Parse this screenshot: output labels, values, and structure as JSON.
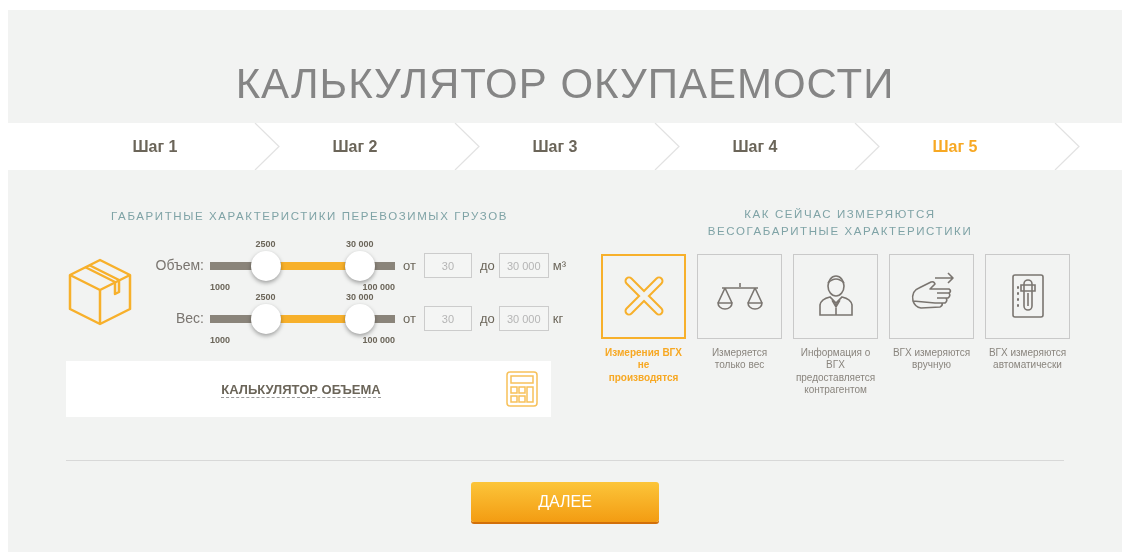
{
  "title": "КАЛЬКУЛЯТОР ОКУПАЕМОСТИ",
  "steps": [
    {
      "label": "Шаг 1",
      "selected": false
    },
    {
      "label": "Шаг 2",
      "selected": false
    },
    {
      "label": "Шаг 3",
      "selected": false
    },
    {
      "label": "Шаг 4",
      "selected": false
    },
    {
      "label": "Шаг 5",
      "selected": true
    }
  ],
  "cargo": {
    "heading": "ГАБАРИТНЫЕ ХАРАКТЕРИСТИКИ ПЕРЕВОЗИМЫХ  ГРУЗОВ",
    "sliders": [
      {
        "label": "Объем:",
        "min_label": "1000",
        "max_label": "100 000",
        "thumbs": [
          {
            "label": "2500",
            "level": 0.3
          },
          {
            "label": "30 000",
            "level": 0.81
          }
        ],
        "from_label": "от",
        "from_value": "30",
        "to_label": "до",
        "to_value": "30 000",
        "unit": "м³"
      },
      {
        "label": "Вес:",
        "min_label": "1000",
        "max_label": "100 000",
        "thumbs": [
          {
            "label": "2500",
            "level": 0.3
          },
          {
            "label": "30 000",
            "level": 0.81
          }
        ],
        "from_label": "от",
        "from_value": "30",
        "to_label": "до",
        "to_value": "30 000",
        "unit": "кг"
      }
    ],
    "calculator_link": "КАЛЬКУЛЯТОР ОБЪЕМА"
  },
  "measurement": {
    "heading_lines": [
      "КАК СЕЙЧАС ИЗМЕРЯЮТСЯ",
      "ВЕСОГАБАРИТНЫЕ ХАРАКТЕРИСТИКИ"
    ],
    "options": [
      {
        "kind": "none",
        "label": "Измерения ВГХ не производятся",
        "selected": true
      },
      {
        "kind": "scales",
        "label": "Измеряется только вес",
        "selected": false
      },
      {
        "kind": "person",
        "label": "Информация о ВГХ предоставляется контрагентом",
        "selected": false
      },
      {
        "kind": "hand",
        "label": "ВГХ измеряются вручную",
        "selected": false
      },
      {
        "kind": "device",
        "label": "ВГХ измеряются автоматически",
        "selected": false
      }
    ]
  },
  "next_button": "ДАЛЕЕ"
}
